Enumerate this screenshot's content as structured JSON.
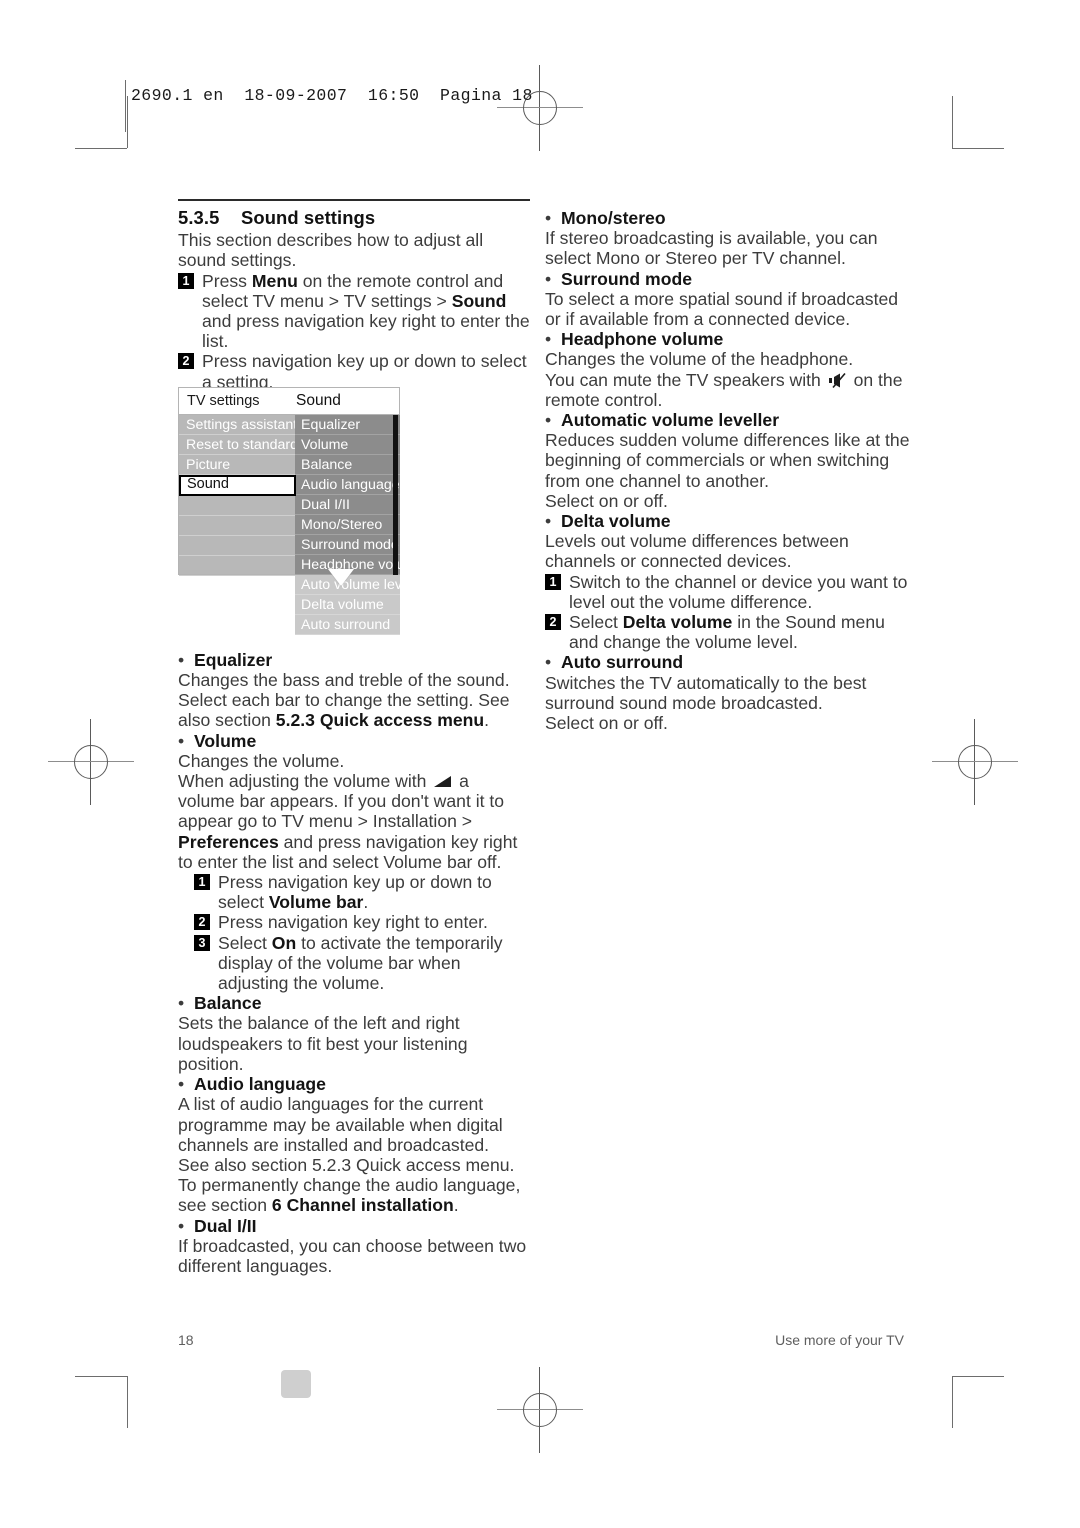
{
  "page": {
    "slug": "2690.1 en  18-09-2007  16:50  Pagina 18",
    "folio": "18",
    "running_head": "Use more of your TV"
  },
  "section": {
    "number": "5.3.5",
    "title": "Sound settings",
    "intro": "This section describes how to adjust all sound settings.",
    "steps": [
      {
        "num": "1",
        "text_parts": [
          "Press ",
          "Menu",
          " on the remote control and select TV menu > TV settings > ",
          "Sound",
          " and press navigation key right to enter the list."
        ]
      },
      {
        "num": "2",
        "text": "Press navigation key up or down to select a setting."
      }
    ]
  },
  "figure": {
    "name": "tv-settings-sound-menu",
    "header_left": "TV settings",
    "header_right": "Sound",
    "left_items": [
      {
        "label": "Settings assistant",
        "selected": false
      },
      {
        "label": "Reset to standard",
        "selected": false
      },
      {
        "label": "Picture",
        "selected": false
      },
      {
        "label": "Sound",
        "selected": true
      },
      {
        "label": "",
        "selected": false
      },
      {
        "label": "",
        "selected": false
      },
      {
        "label": "",
        "selected": false
      },
      {
        "label": "",
        "selected": false
      }
    ],
    "right_items": [
      {
        "label": "Equalizer",
        "dimmed": false
      },
      {
        "label": "Volume",
        "dimmed": false
      },
      {
        "label": "Balance",
        "dimmed": false
      },
      {
        "label": "Audio language",
        "dimmed": false
      },
      {
        "label": "Dual I/II",
        "dimmed": false
      },
      {
        "label": "Mono/Stereo",
        "dimmed": false
      },
      {
        "label": "Surround mode",
        "dimmed": false
      },
      {
        "label": "Headphone volume",
        "dimmed": false
      },
      {
        "label": "Auto volume level...",
        "dimmed": true
      },
      {
        "label": "Delta volume",
        "dimmed": true
      },
      {
        "label": "Auto surround",
        "dimmed": true
      }
    ],
    "colors": {
      "header_bg": "#ffffff",
      "left_panel": "#b8b8b8",
      "right_panel": "#8c8c8c",
      "ghost_panel": "#c9c9c9",
      "scrollbar": "#121212",
      "selected_border": "#000000"
    }
  },
  "left_column": {
    "entries": [
      {
        "title": "Equalizer",
        "body": [
          {
            "type": "text_bold_tail",
            "parts": [
              "Changes the bass and treble of the sound. Select each bar to change the setting. See also section ",
              "5.2.3 Quick access menu",
              "."
            ]
          }
        ]
      },
      {
        "title": "Volume",
        "body": [
          {
            "type": "text",
            "value": "Changes the volume."
          },
          {
            "type": "icon_text",
            "before": "When adjusting the volume with ",
            "icon": "volume-triangle-icon",
            "after": " a volume bar appears. If you don't want it to appear go to "
          },
          {
            "type": "bold_inline",
            "parts": [
              "TV menu > Installation > ",
              "Preferences",
              " and press navigation key right to enter the list and select Volume bar off."
            ]
          }
        ],
        "steps": [
          {
            "num": "1",
            "parts": [
              "Press navigation key up or down to select ",
              "Volume bar",
              "."
            ]
          },
          {
            "num": "2",
            "parts": [
              "Press navigation key right to enter.",
              "",
              ""
            ]
          },
          {
            "num": "3",
            "parts": [
              "Select ",
              "On",
              " to activate the temporarily display of the volume bar when adjusting the volume."
            ]
          }
        ]
      },
      {
        "title": "Balance",
        "body": [
          {
            "type": "text",
            "value": "Sets the balance of the left and right loudspeakers to fit best your listening position."
          }
        ]
      },
      {
        "title": "Audio language",
        "body": [
          {
            "type": "text",
            "value": "A list of audio languages for the current programme may be available when digital channels are installed and broadcasted."
          },
          {
            "type": "text",
            "value": "See also section 5.2.3 Quick access menu."
          },
          {
            "type": "bold_inline",
            "parts": [
              "To permanently change the audio language, see section ",
              "6 Channel installation",
              "."
            ]
          }
        ]
      },
      {
        "title": "Dual I/II",
        "body": [
          {
            "type": "text",
            "value": "If broadcasted, you can choose between two different languages."
          }
        ]
      }
    ]
  },
  "right_column": {
    "entries": [
      {
        "title": "Mono/stereo",
        "body": [
          {
            "type": "text",
            "value": "If stereo broadcasting is available, you can select Mono or Stereo per TV channel."
          }
        ]
      },
      {
        "title": "Surround mode",
        "body": [
          {
            "type": "text",
            "value": "To select a more spatial sound if broadcasted or if available from a connected device."
          }
        ]
      },
      {
        "title": "Headphone volume",
        "body": [
          {
            "type": "text",
            "value": "Changes the volume of the headphone."
          },
          {
            "type": "icon_text",
            "before": "You can mute the TV speakers with ",
            "icon": "mute-speaker-icon",
            "after": " on the remote control."
          }
        ]
      },
      {
        "title": "Automatic volume leveller",
        "body": [
          {
            "type": "text",
            "value": "Reduces sudden volume differences like at the beginning of commercials or when switching from one channel to another."
          },
          {
            "type": "text",
            "value": "Select on or off."
          }
        ]
      },
      {
        "title": "Delta volume",
        "body": [
          {
            "type": "text",
            "value": "Levels out volume differences between channels or connected devices."
          }
        ],
        "steps": [
          {
            "num": "1",
            "parts": [
              "Switch to the channel or device you want to level out the volume difference.",
              "",
              ""
            ]
          },
          {
            "num": "2",
            "parts": [
              "Select ",
              "Delta volume",
              " in the Sound menu and change the volume level."
            ]
          }
        ]
      },
      {
        "title": "Auto surround",
        "body": [
          {
            "type": "text",
            "value": "Switches the TV automatically to the best surround sound mode broadcasted."
          },
          {
            "type": "text",
            "value": "Select on or off."
          }
        ]
      }
    ]
  }
}
